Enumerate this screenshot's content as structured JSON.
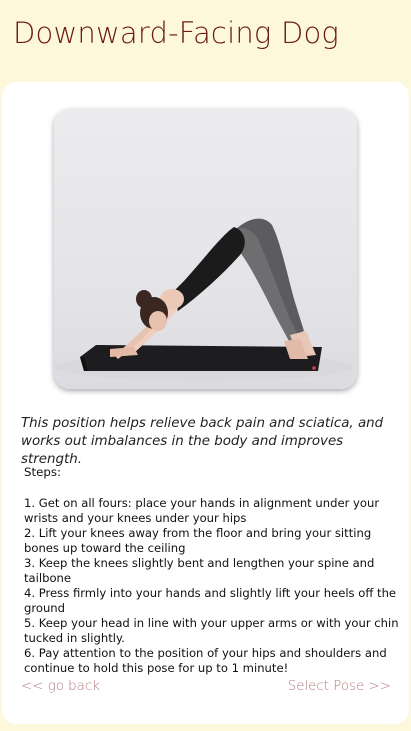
{
  "header": {
    "title": "Downward-Facing Dog"
  },
  "pose": {
    "description": "This position helps relieve back pain and sciatica, and works out imbalances in the body and improves strength.",
    "steps_heading": "Steps:",
    "steps": [
      "1. Get on all fours: place your hands in alignment under your wrists and your knees under your hips",
      "2. Lift your knees away from the floor and bring your sitting bones up toward the ceiling",
      "3. Keep the knees slightly bent and lengthen your spine and tailbone",
      "4. Press firmly into your hands and slightly lift your heels off the ground",
      "5. Keep your head in line with your upper arms or with your chin tucked in slightly.",
      "6. Pay attention to the position of your hips and shoulders and continue to hold this pose for up to 1 minute!"
    ]
  },
  "nav": {
    "back_label": "<< go back",
    "select_label": "Select Pose >>"
  }
}
